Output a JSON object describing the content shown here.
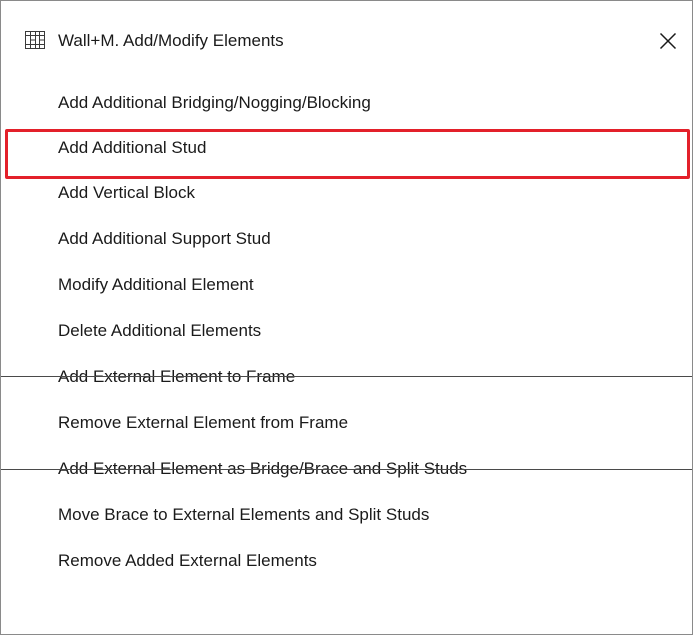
{
  "window": {
    "title": "Wall+M. Add/Modify Elements",
    "icon": "wall-frame-icon",
    "close_glyph": "✕"
  },
  "menu": {
    "items": [
      {
        "label": "Add Additional Bridging/Nogging/Blocking"
      },
      {
        "label": "Add Additional Stud",
        "highlighted": true
      },
      {
        "label": "Add Vertical Block"
      },
      {
        "label": "Add Additional Support Stud"
      },
      {
        "label": "Modify Additional Element"
      },
      {
        "label": "Delete Additional Elements"
      },
      {
        "label": "Add External Element to Frame"
      },
      {
        "label": "Remove External Element from Frame"
      },
      {
        "label": "Add External Element as Bridge/Brace and Split Studs"
      },
      {
        "label": "Move Brace to External Elements and Split Studs"
      },
      {
        "label": "Remove Added External Elements"
      }
    ]
  },
  "colors": {
    "highlight_border": "#e3202a",
    "separator": "#4a4a4a",
    "text": "#1a1a1a"
  }
}
